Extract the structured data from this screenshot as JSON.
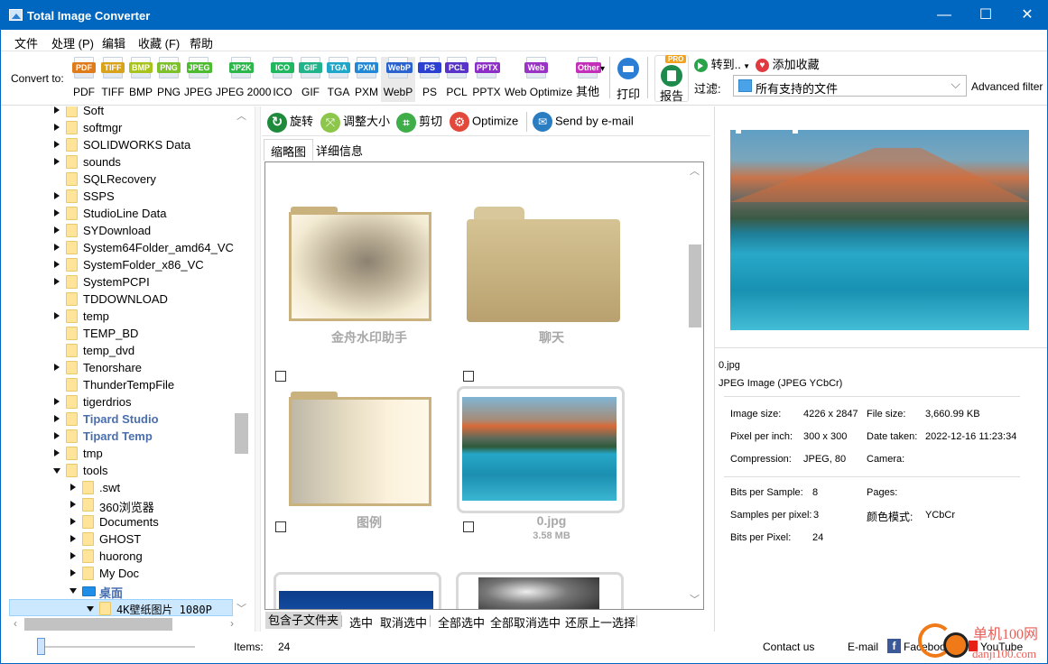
{
  "window": {
    "title": "Total Image Converter",
    "controls": {
      "minimize": "—",
      "maximize": "☐",
      "close": "✕"
    }
  },
  "menu": [
    "文件",
    "处理 (P)",
    "编辑",
    "收藏 (F)",
    "帮助"
  ],
  "toolbar": {
    "convert_label": "Convert to:",
    "formats": [
      {
        "badge": "PDF",
        "label": "PDF",
        "color": "#e07b1c"
      },
      {
        "badge": "TIFF",
        "label": "TIFF",
        "color": "#d9a21b"
      },
      {
        "badge": "BMP",
        "label": "BMP",
        "color": "#a8c31c"
      },
      {
        "badge": "PNG",
        "label": "PNG",
        "color": "#7cc12a"
      },
      {
        "badge": "JPEG",
        "label": "JPEG",
        "color": "#4dbb2f"
      },
      {
        "badge": "JP2K",
        "label": "JPEG 2000",
        "color": "#2db64a"
      },
      {
        "badge": "ICO",
        "label": "ICO",
        "color": "#1fb85e"
      },
      {
        "badge": "GIF",
        "label": "GIF",
        "color": "#21b38a"
      },
      {
        "badge": "TGA",
        "label": "TGA",
        "color": "#1fa7c9"
      },
      {
        "badge": "PXM",
        "label": "PXM",
        "color": "#2288d6"
      },
      {
        "badge": "WebP",
        "label": "WebP",
        "color": "#2a62cf"
      },
      {
        "badge": "PS",
        "label": "PS",
        "color": "#2b3fd0"
      },
      {
        "badge": "PCL",
        "label": "PCL",
        "color": "#5a34c9"
      },
      {
        "badge": "PPTX",
        "label": "PPTX",
        "color": "#8b2fc6"
      },
      {
        "badge": "Web",
        "label": "Web Optimize",
        "color": "#9a33c3"
      },
      {
        "badge": "Other",
        "label": "其他",
        "color": "#c32fb8"
      }
    ],
    "selected_format": "WebP",
    "print_label": "打印",
    "report_label": "报告",
    "pro_badge": "PRO",
    "goto_label": "转到..",
    "favorite_label": "添加收藏",
    "filter_label": "过滤:",
    "filter_value": "所有支持的文件",
    "advanced_filter": "Advanced filter"
  },
  "tree": {
    "items": [
      {
        "label": "Soft",
        "level": 0,
        "arrow": "right"
      },
      {
        "label": "softmgr",
        "level": 0,
        "arrow": "right"
      },
      {
        "label": "SOLIDWORKS Data",
        "level": 0,
        "arrow": "right"
      },
      {
        "label": "sounds",
        "level": 0,
        "arrow": "right"
      },
      {
        "label": "SQLRecovery",
        "level": 0,
        "arrow": "none"
      },
      {
        "label": "SSPS",
        "level": 0,
        "arrow": "right"
      },
      {
        "label": "StudioLine Data",
        "level": 0,
        "arrow": "right"
      },
      {
        "label": "SYDownload",
        "level": 0,
        "arrow": "right"
      },
      {
        "label": "System64Folder_amd64_VC",
        "level": 0,
        "arrow": "right"
      },
      {
        "label": "SystemFolder_x86_VC",
        "level": 0,
        "arrow": "right"
      },
      {
        "label": "SystemPCPI",
        "level": 0,
        "arrow": "right"
      },
      {
        "label": "TDDOWNLOAD",
        "level": 0,
        "arrow": "none"
      },
      {
        "label": "temp",
        "level": 0,
        "arrow": "right"
      },
      {
        "label": "TEMP_BD",
        "level": 0,
        "arrow": "none"
      },
      {
        "label": "temp_dvd",
        "level": 0,
        "arrow": "none"
      },
      {
        "label": "Tenorshare",
        "level": 0,
        "arrow": "right"
      },
      {
        "label": "ThunderTempFile",
        "level": 0,
        "arrow": "none"
      },
      {
        "label": "tigerdrios",
        "level": 0,
        "arrow": "right"
      },
      {
        "label": "Tipard Studio",
        "level": 0,
        "arrow": "right",
        "bold": true
      },
      {
        "label": "Tipard Temp",
        "level": 0,
        "arrow": "right",
        "bold": true
      },
      {
        "label": "tmp",
        "level": 0,
        "arrow": "right"
      },
      {
        "label": "tools",
        "level": 0,
        "arrow": "down"
      },
      {
        "label": ".swt",
        "level": 1,
        "arrow": "right"
      },
      {
        "label": "360浏览器",
        "level": 1,
        "arrow": "right"
      },
      {
        "label": "Documents",
        "level": 1,
        "arrow": "right"
      },
      {
        "label": "GHOST",
        "level": 1,
        "arrow": "right"
      },
      {
        "label": "huorong",
        "level": 1,
        "arrow": "right"
      },
      {
        "label": "My Doc",
        "level": 1,
        "arrow": "right"
      },
      {
        "label": "桌面",
        "level": 1,
        "arrow": "down",
        "bold": true,
        "blue": true
      },
      {
        "label": "4K壁纸图片 1080P",
        "level": 2,
        "arrow": "down",
        "selected": true
      }
    ]
  },
  "actions": {
    "rotate": "旋转",
    "resize": "调整大小",
    "crop": "剪切",
    "optimize": "Optimize",
    "email": "Send by e-mail"
  },
  "tabs": {
    "thumbnails": "缩略图",
    "details": "详细信息"
  },
  "files": [
    {
      "name": "金舟水印助手",
      "type": "folder-image"
    },
    {
      "name": "聊天",
      "type": "folder"
    },
    {
      "name": "图例",
      "type": "folder-image"
    },
    {
      "name": "0.jpg",
      "size": "3.58 MB",
      "type": "image"
    }
  ],
  "selection_bar": {
    "include_subfolders": "包含子文件夹",
    "select": "选中",
    "deselect": "取消选中",
    "select_all": "全部选中",
    "deselect_all": "全部取消选中",
    "restore": "还原上一选择"
  },
  "details": {
    "filename": "0.jpg",
    "format": "JPEG Image (JPEG YCbCr)",
    "image_size_label": "Image size:",
    "image_size": "4226 x 2847",
    "file_size_label": "File size:",
    "file_size": "3,660.99 KB",
    "ppi_label": "Pixel per inch:",
    "ppi": "300 x 300",
    "date_label": "Date taken:",
    "date": "2022-12-16 11:23:34",
    "compression_label": "Compression:",
    "compression": "JPEG, 80",
    "camera_label": "Camera:",
    "camera": "",
    "bps_label": "Bits per Sample:",
    "bps": "8",
    "pages_label": "Pages:",
    "pages": "",
    "spp_label": "Samples per pixel:",
    "spp": "3",
    "color_mode_label": "颜色模式:",
    "color_mode": "YCbCr",
    "bpp_label": "Bits per Pixel:",
    "bpp": "24"
  },
  "status": {
    "items_label": "Items:",
    "items": "24",
    "contact": "Contact us",
    "email": "E-mail",
    "facebook": "Facebook",
    "youtube": "YouTube",
    "thumb_size_fraction": 0.0
  },
  "watermark": {
    "text1": "单机100网",
    "text2": "danji100.com"
  }
}
